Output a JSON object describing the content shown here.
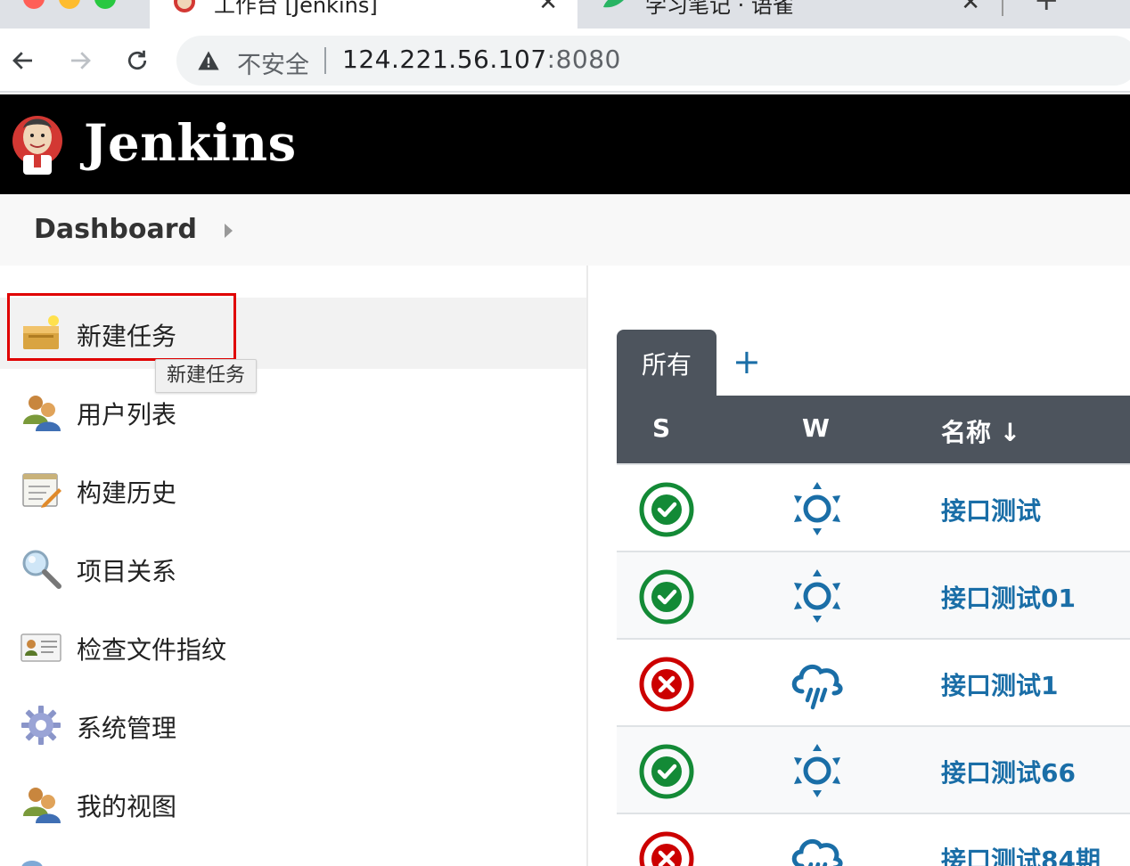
{
  "browser": {
    "tabs": [
      {
        "title": "工作台 [Jenkins]",
        "active": true
      },
      {
        "title": "学习笔记 · 语雀",
        "active": false
      }
    ],
    "security_label": "不安全",
    "url_host": "124.221.56.107",
    "url_port": ":8080"
  },
  "header": {
    "title": "Jenkins"
  },
  "breadcrumb": {
    "items": [
      "Dashboard"
    ]
  },
  "sidebar": {
    "tasks": [
      {
        "label": "新建任务",
        "icon": "new-item-icon"
      },
      {
        "label": "用户列表",
        "icon": "users-icon"
      },
      {
        "label": "构建历史",
        "icon": "build-history-icon"
      },
      {
        "label": "项目关系",
        "icon": "search-icon"
      },
      {
        "label": "检查文件指纹",
        "icon": "fingerprint-icon"
      },
      {
        "label": "系统管理",
        "icon": "gear-icon"
      },
      {
        "label": "我的视图",
        "icon": "users-icon"
      }
    ],
    "tooltip": "新建任务"
  },
  "main": {
    "view_tab": "所有",
    "add_tab": "+",
    "columns": {
      "status": "S",
      "weather": "W",
      "name": "名称 ↓"
    },
    "jobs": [
      {
        "status": "success",
        "weather": "sunny",
        "name": "接口测试"
      },
      {
        "status": "success",
        "weather": "sunny",
        "name": "接口测试01"
      },
      {
        "status": "failed",
        "weather": "rain",
        "name": "接口测试1"
      },
      {
        "status": "success",
        "weather": "sunny",
        "name": "接口测试66"
      },
      {
        "status": "failed",
        "weather": "rain",
        "name": "接口测试84期"
      }
    ]
  },
  "colors": {
    "header_bg": "#000000",
    "link": "#1a6ea7",
    "success": "#138a36",
    "failure": "#cc0000",
    "table_header": "#4d545d"
  }
}
